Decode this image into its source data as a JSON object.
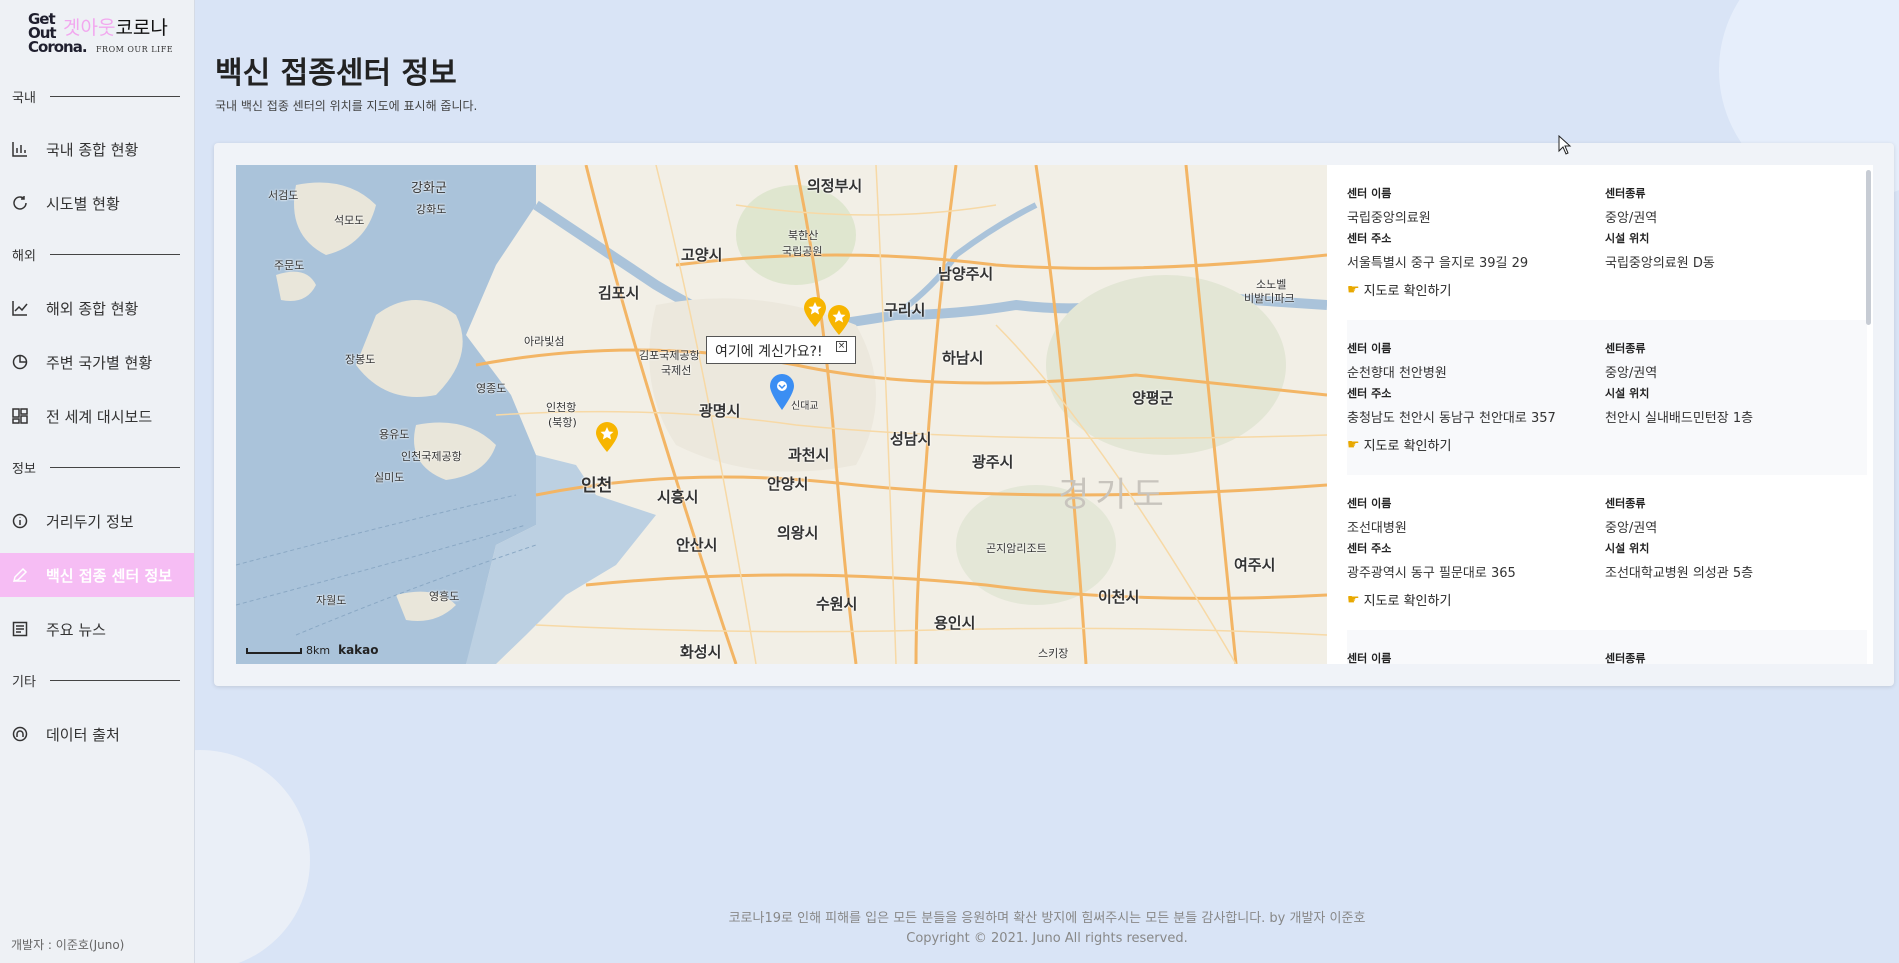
{
  "logo": {
    "letters": [
      "Get",
      "Out",
      "Corona."
    ],
    "title_pink": "겟아웃",
    "title_dark": "코로나",
    "tagline": "FROM OUR LIFE"
  },
  "sidebar": {
    "sections": {
      "domestic": "국내",
      "overseas": "해외",
      "info": "정보",
      "etc": "기타"
    },
    "items": [
      {
        "label": "국내 종합 현황",
        "icon": "bar-chart-icon"
      },
      {
        "label": "시도별 현황",
        "icon": "circle-refresh-icon"
      },
      {
        "label": "해외 종합 현황",
        "icon": "line-chart-icon"
      },
      {
        "label": "주변 국가별 현황",
        "icon": "pie-chart-icon"
      },
      {
        "label": "전 세계 대시보드",
        "icon": "dashboard-icon"
      },
      {
        "label": "거리두기 정보",
        "icon": "info-icon"
      },
      {
        "label": "백신 접종 센터 정보",
        "icon": "pen-icon",
        "active": true
      },
      {
        "label": "주요 뉴스",
        "icon": "news-icon"
      },
      {
        "label": "데이터 출처",
        "icon": "source-icon"
      }
    ],
    "developer": "개발자 : 이준호(Juno)"
  },
  "header": {
    "title": "백신 접종센터 정보",
    "subtitle": "국내 백신 접종 센터의 위치를 지도에 표시해 줍니다."
  },
  "map": {
    "popup_text": "여기에 계신가요?!",
    "popup_close": "×",
    "scale_text": "8km",
    "brand": "kakao",
    "labels": {
      "uijeongbu": "의정부시",
      "ganghwagun": "강화군",
      "ganghwado": "강화도",
      "seogeomdo": "서검도",
      "seongmodo": "석모도",
      "jumundo": "주문도",
      "gimpo": "김포시",
      "goyang": "고양시",
      "bukhansan": "북한산",
      "national_park": "국립공원",
      "namyangju": "남양주시",
      "guri": "구리시",
      "hanam": "하남시",
      "yangpyeong": "양평군",
      "gwangmyeong": "광명시",
      "gwacheon": "과천시",
      "seongnam": "성남시",
      "gwangju": "광주시",
      "incheon": "인천",
      "siheung": "시흥시",
      "anyang": "안양시",
      "ansan": "안산시",
      "uiwang": "의왕시",
      "suwon": "수원시",
      "hwaseong": "화성시",
      "yongin": "용인시",
      "icheon": "이천시",
      "yeoju": "여주시",
      "gyeonggido": "경기도",
      "yeongjongdo": "영종도",
      "yongyudo": "용유도",
      "silmido": "실미도",
      "incheon_airport": "인천국제공항",
      "gimpo_airport": "김포국제공항",
      "gimpo_airport2": "국제선",
      "jangbongdo": "장봉도",
      "arabitseom": "아라빛섬",
      "jawoldo": "자월도",
      "yeongheungdo": "영흥도",
      "gonjiam": "곤지암리조트",
      "sobaek": "소노벨",
      "vivaldi": "비발디파크",
      "skiing": "스키장",
      "jungang": "신대교",
      "incheonhang": "인천항",
      "bukhang": "(북항)"
    }
  },
  "centers": {
    "labels": {
      "name": "센터 이름",
      "type": "센터종류",
      "address": "센터 주소",
      "facility": "시설 위치",
      "link": "지도로 확인하기"
    },
    "items": [
      {
        "name": "국립중앙의료원",
        "type": "중앙/권역",
        "address": "서울특별시 중구 을지로 39길 29",
        "facility": "국립중앙의료원 D동"
      },
      {
        "name": "순천향대 천안병원",
        "type": "중앙/권역",
        "address": "충청남도 천안시 동남구 천안대로 357",
        "facility": "천안시 실내배드민턴장 1층"
      },
      {
        "name": "조선대병원",
        "type": "중앙/권역",
        "address": "광주광역시 동구 필문대로 365",
        "facility": "조선대학교병원 의성관 5층"
      },
      {
        "name": "",
        "type": "",
        "address": "",
        "facility": ""
      }
    ]
  },
  "footer": {
    "message": "코로나19로 인해 피해를 입은 모든 분들을 응원하며 확산 방지에 힘써주시는 모든 분들 감사합니다. by 개발자 이준호",
    "copyright": "Copyright © 2021. Juno All rights reserved."
  },
  "colors": {
    "accent": "#f6bdf4",
    "background": "#d9e4f6",
    "marker_blue": "#3b8ef3",
    "marker_star": "#f7b500"
  }
}
